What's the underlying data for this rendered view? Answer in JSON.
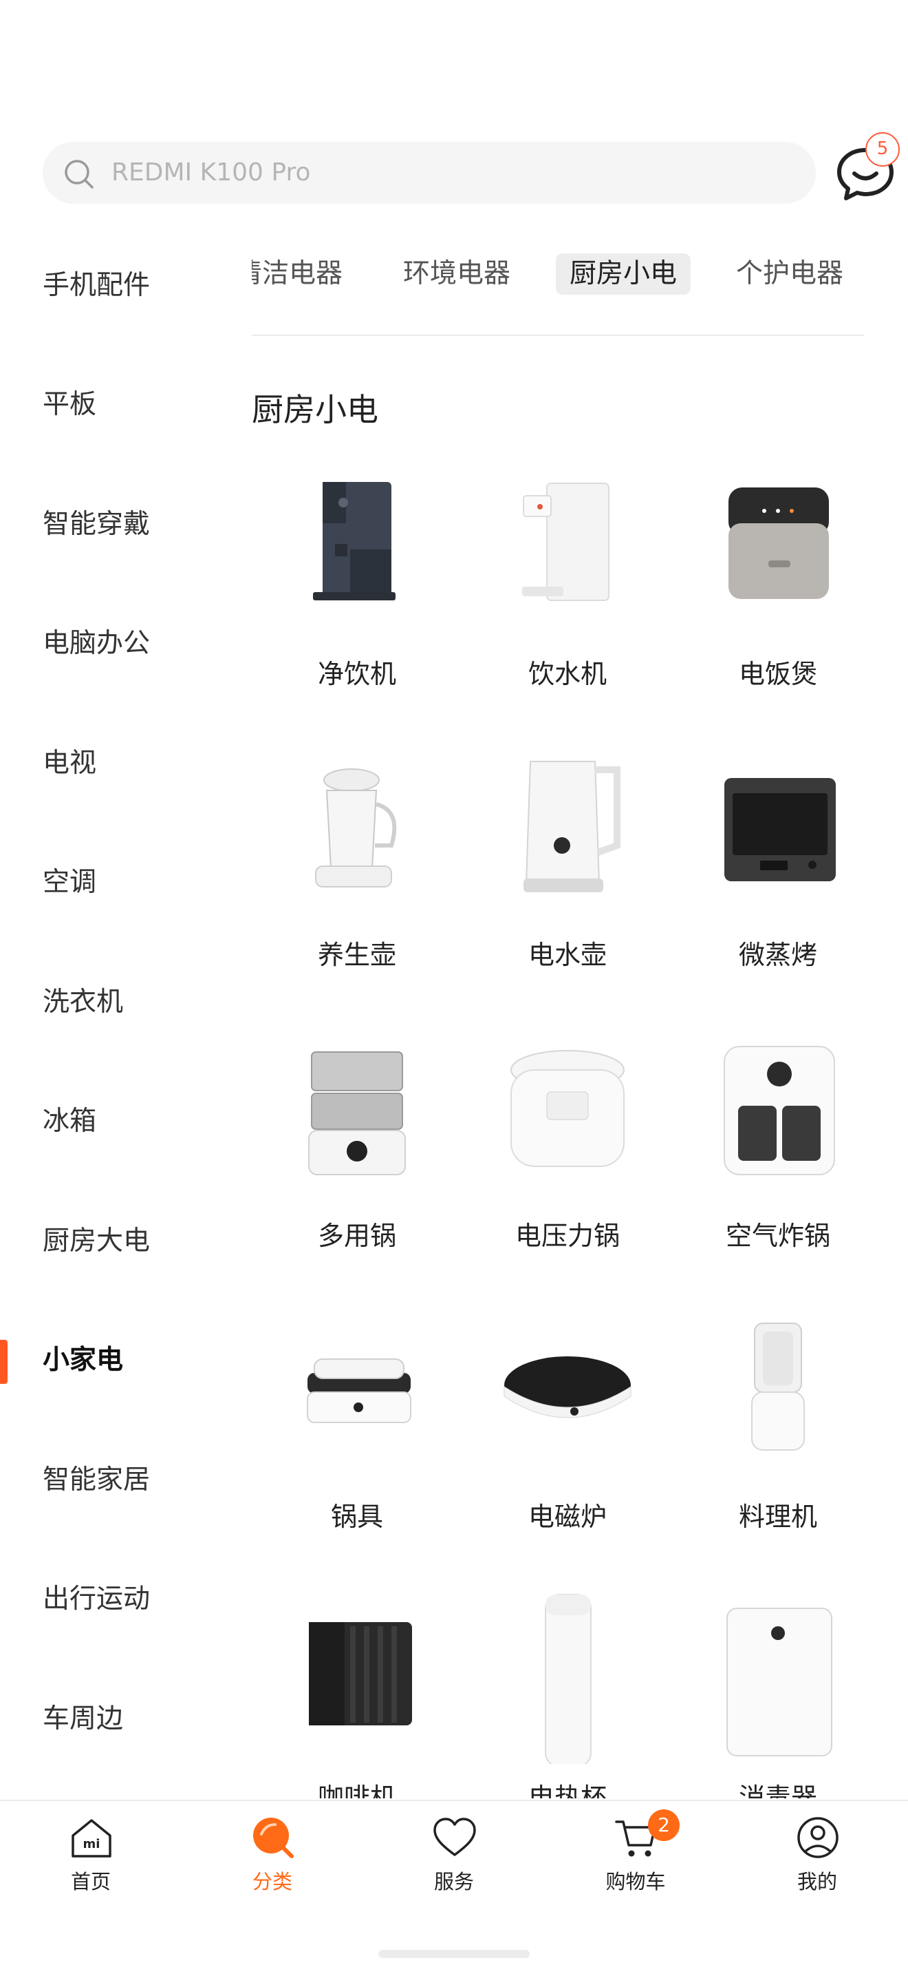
{
  "search": {
    "placeholder": "REDMI K100 Pro",
    "icon": "search-icon"
  },
  "messages": {
    "icon": "chat-bubble-icon",
    "badge": "5"
  },
  "sidebar": {
    "items": [
      {
        "label": "手机配件"
      },
      {
        "label": "平板"
      },
      {
        "label": "智能穿戴"
      },
      {
        "label": "电脑办公"
      },
      {
        "label": "电视"
      },
      {
        "label": "空调"
      },
      {
        "label": "洗衣机"
      },
      {
        "label": "冰箱"
      },
      {
        "label": "厨房大电"
      },
      {
        "label": "小家电"
      },
      {
        "label": "智能家居"
      },
      {
        "label": "出行运动"
      },
      {
        "label": "车周边"
      }
    ],
    "active_index": 9
  },
  "tabs": [
    {
      "label": "清洁电器"
    },
    {
      "label": "环境电器"
    },
    {
      "label": "厨房小电"
    },
    {
      "label": "个护电器"
    }
  ],
  "section_title": "厨房小电",
  "products": [
    {
      "label": "净饮机",
      "icon": "water-purifier-icon"
    },
    {
      "label": "饮水机",
      "icon": "water-dispenser-icon"
    },
    {
      "label": "电饭煲",
      "icon": "rice-cooker-icon"
    },
    {
      "label": "养生壶",
      "icon": "health-pot-icon"
    },
    {
      "label": "电水壶",
      "icon": "electric-kettle-icon"
    },
    {
      "label": "微蒸烤",
      "icon": "steam-oven-icon"
    },
    {
      "label": "多用锅",
      "icon": "multi-cooker-icon"
    },
    {
      "label": "电压力锅",
      "icon": "pressure-cooker-icon"
    },
    {
      "label": "空气炸锅",
      "icon": "air-fryer-icon"
    },
    {
      "label": "锅具",
      "icon": "grill-pan-icon"
    },
    {
      "label": "电磁炉",
      "icon": "induction-cooker-icon"
    },
    {
      "label": "料理机",
      "icon": "blender-icon"
    },
    {
      "label": "咖啡机",
      "icon": "coffee-machine-icon"
    },
    {
      "label": "电热杯",
      "icon": "thermal-cup-icon"
    },
    {
      "label": "消毒器",
      "icon": "sterilizer-icon"
    }
  ],
  "bottom_nav": [
    {
      "label": "首页",
      "icon": "home-icon"
    },
    {
      "label": "分类",
      "icon": "category-icon"
    },
    {
      "label": "服务",
      "icon": "heart-icon"
    },
    {
      "label": "购物车",
      "icon": "cart-icon",
      "badge": "2"
    },
    {
      "label": "我的",
      "icon": "profile-icon"
    }
  ],
  "colors": {
    "accent": "#ff6a16",
    "indicator": "#ff5722",
    "badge_red": "#ff5a3a"
  }
}
